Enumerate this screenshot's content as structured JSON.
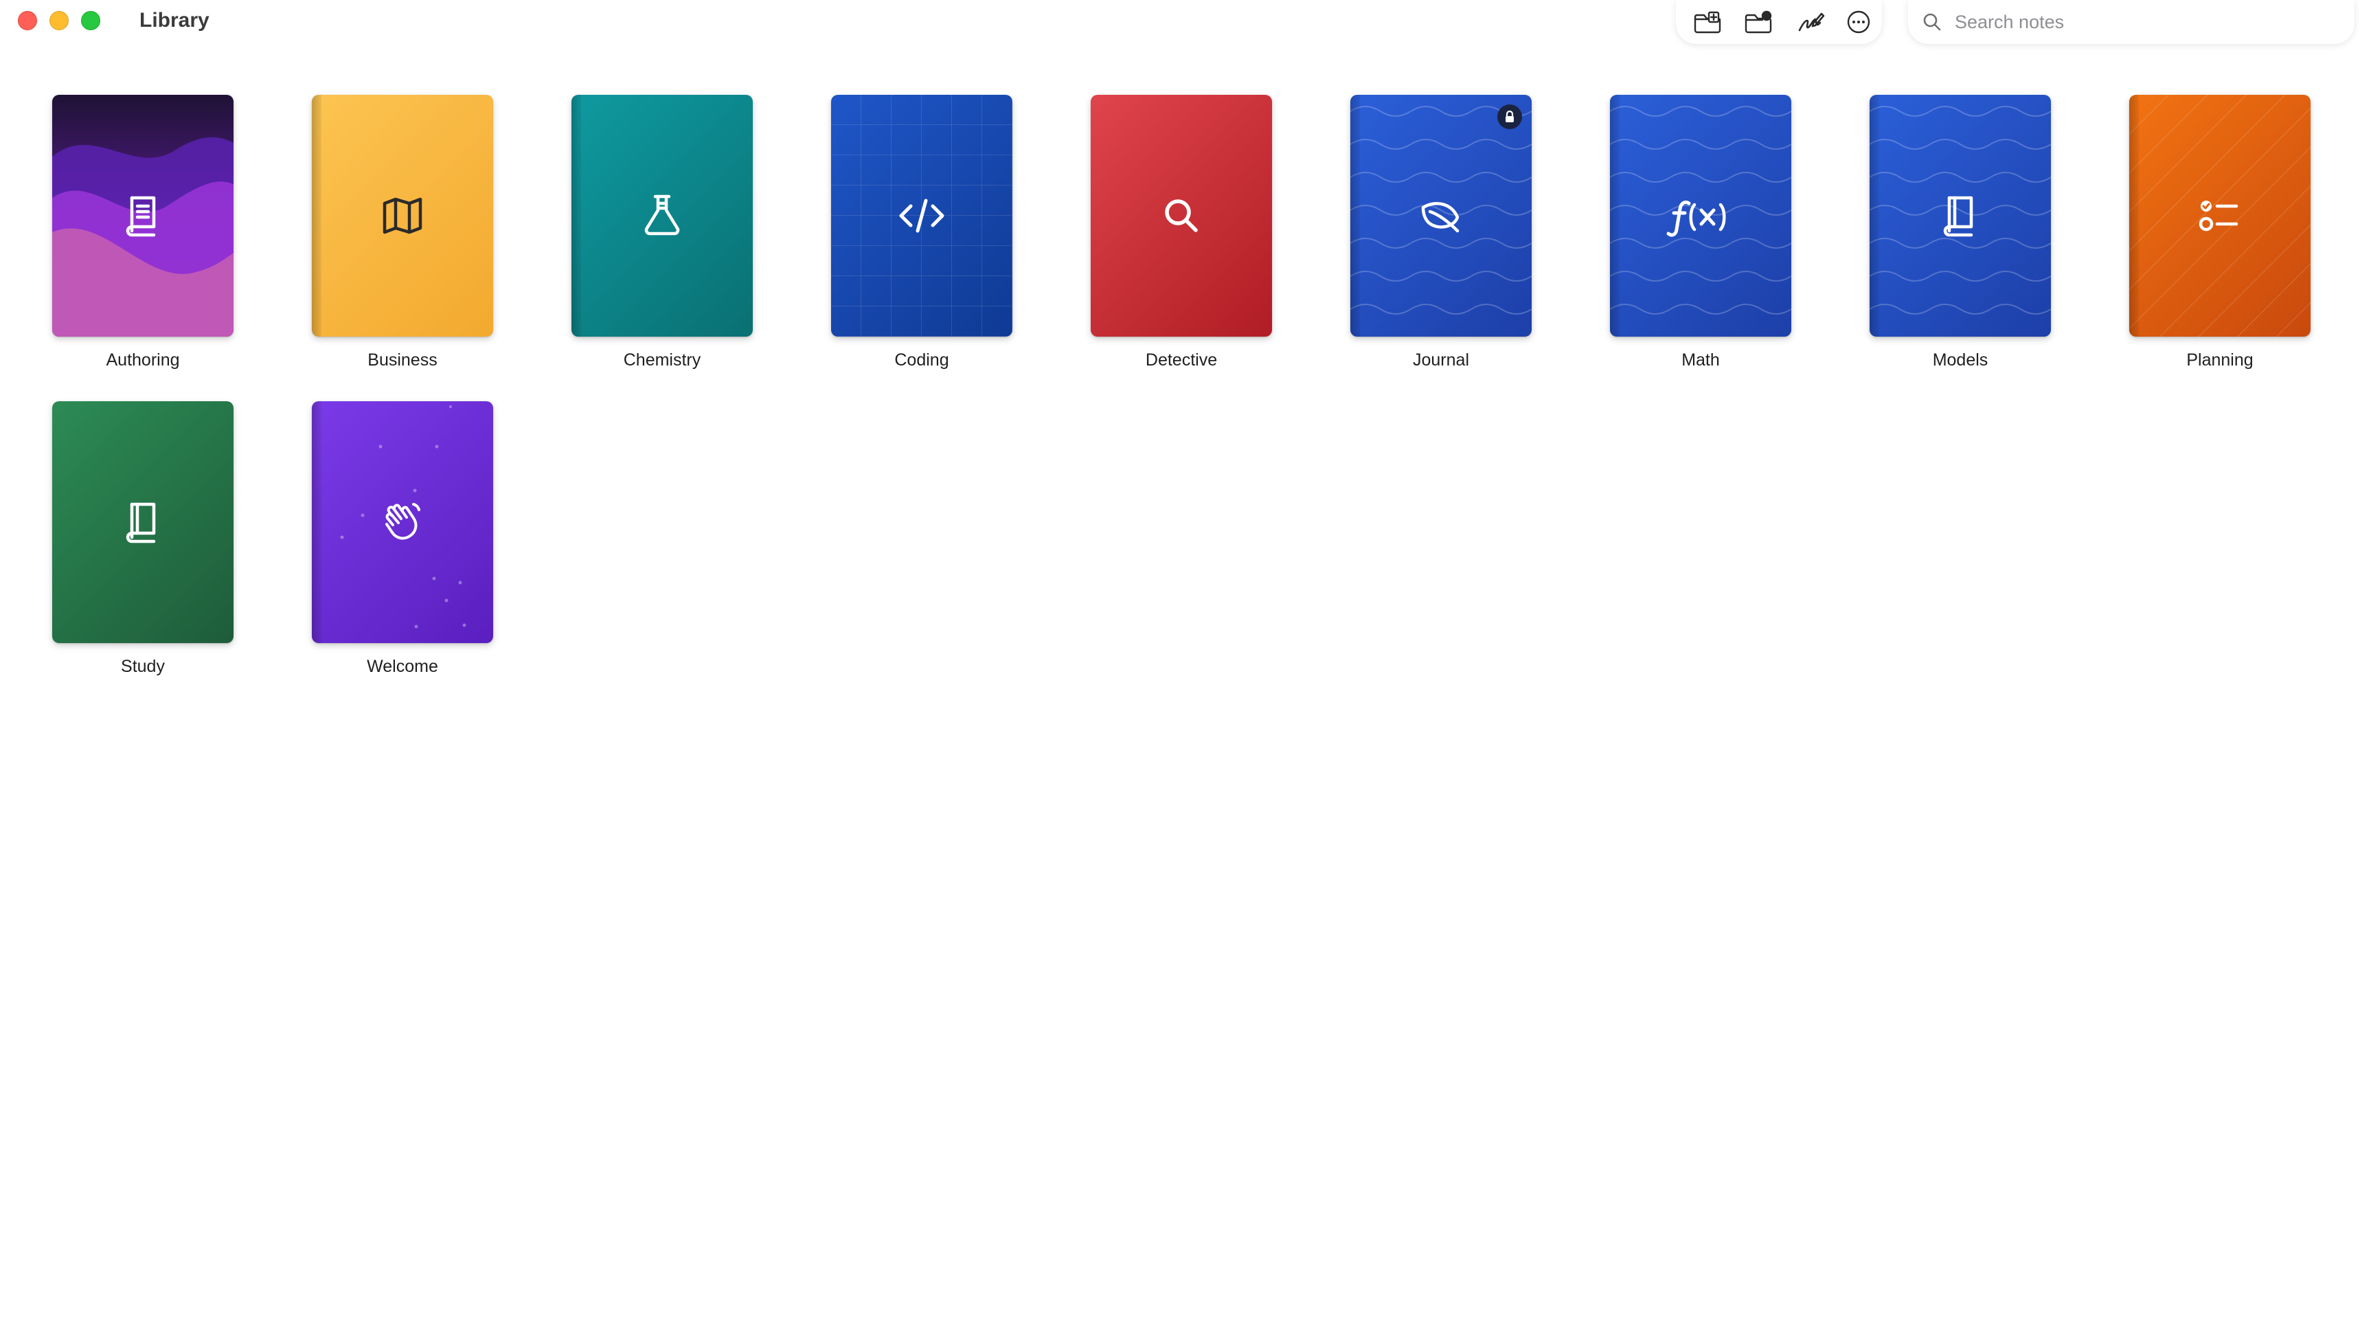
{
  "window": {
    "title": "Library"
  },
  "toolbar": {
    "buttons": [
      {
        "name": "new-notebook",
        "icon": "folder-plus-icon"
      },
      {
        "name": "import",
        "icon": "folder-badge-icon"
      },
      {
        "name": "scribble",
        "icon": "signature-pen-icon"
      },
      {
        "name": "more",
        "icon": "ellipsis-circle-icon"
      }
    ]
  },
  "search": {
    "placeholder": "Search notes",
    "value": ""
  },
  "notebooks": [
    {
      "label": "Authoring",
      "icon": "book-pages-icon",
      "color": "#4a1a7a"
    },
    {
      "label": "Business",
      "icon": "map-icon",
      "color": "#f3a92f"
    },
    {
      "label": "Chemistry",
      "icon": "flask-icon",
      "color": "#0e9aa0"
    },
    {
      "label": "Coding",
      "icon": "code-brackets-icon",
      "color": "#1f56c8"
    },
    {
      "label": "Detective",
      "icon": "magnifier-icon",
      "color": "#d0323a"
    },
    {
      "label": "Journal",
      "icon": "leaf-icon",
      "color": "#2b5fd9",
      "locked": true
    },
    {
      "label": "Math",
      "icon": "function-icon",
      "color": "#2b5fd9"
    },
    {
      "label": "Models",
      "icon": "book-icon",
      "color": "#2b5fd9"
    },
    {
      "label": "Planning",
      "icon": "checklist-icon",
      "color": "#f27312"
    },
    {
      "label": "Study",
      "icon": "book-icon",
      "color": "#2c8b55"
    },
    {
      "label": "Welcome",
      "icon": "waving-hand-icon",
      "color": "#7a3be8"
    }
  ]
}
